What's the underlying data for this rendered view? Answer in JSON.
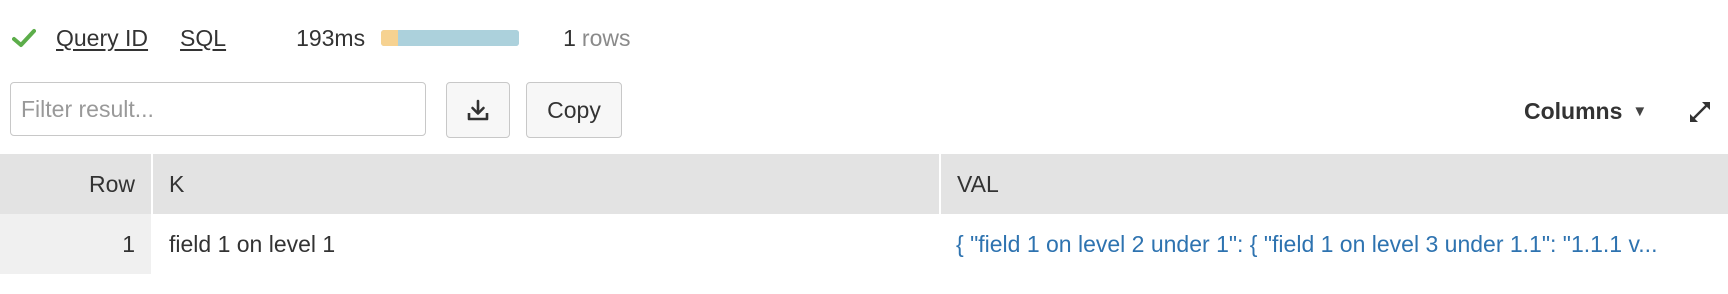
{
  "status": {
    "success": true,
    "query_id_label": "Query ID",
    "sql_label": "SQL",
    "duration": "193ms",
    "timing": {
      "queue_fraction": 0.12,
      "execution_fraction": 0.88,
      "queue_color": "#f6d291",
      "execution_color": "#acd1dc"
    },
    "row_count": "1",
    "row_count_label": "rows"
  },
  "toolbar": {
    "filter_placeholder": "Filter result...",
    "filter_value": "",
    "download_icon": "download-icon",
    "copy_label": "Copy",
    "columns_label": "Columns",
    "expand_icon": "expand-icon"
  },
  "table": {
    "headers": [
      "Row",
      "K",
      "VAL"
    ],
    "rows": [
      {
        "row": "1",
        "k": "field 1 on level 1",
        "val": "{ \"field 1 on level 2 under 1\": { \"field 1 on level 3 under 1.1\": \"1.1.1 v..."
      }
    ]
  },
  "colors": {
    "success_check": "#5cad4a",
    "link_value": "#2e73b0",
    "header_bg": "#e3e3e3"
  }
}
